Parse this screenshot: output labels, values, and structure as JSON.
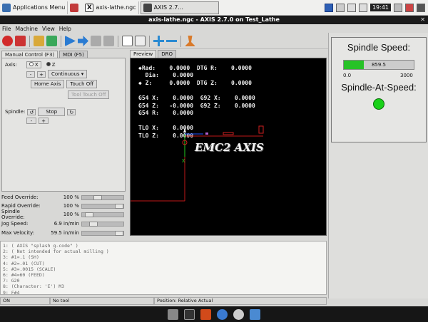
{
  "panel": {
    "apps_menu": "Applications Menu",
    "task1": "axis-lathe.ngc",
    "task2": "AXIS 2.7...",
    "clock": "19:41"
  },
  "window": {
    "title": "axis-lathe.ngc - AXIS 2.7.0 on Test_Lathe"
  },
  "menu": {
    "file": "File",
    "machine": "Machine",
    "view": "View",
    "help": "Help"
  },
  "left": {
    "tab_manual": "Manual Control (F3)",
    "tab_mdi": "MDI (F5)",
    "axis_label": "Axis:",
    "axis_x": "X",
    "axis_z": "Z",
    "jog_mode": "Continuous",
    "home_axis": "Home Axis",
    "touch_off": "Touch Off",
    "tool_touch_off": "Tool Touch Off",
    "spindle_label": "Spindle:",
    "spindle_stop": "Stop"
  },
  "overrides": {
    "feed_label": "Feed Override:",
    "feed_val": "100 %",
    "rapid_label": "Rapid Override:",
    "rapid_val": "100 %",
    "spindle_label": "Spindle Override:",
    "spindle_val": "100 %",
    "jog_label": "Jog Speed:",
    "jog_val": "6.9 in/min",
    "maxvel_label": "Max Velocity:",
    "maxvel_val": "59.5 in/min"
  },
  "preview": {
    "tab_preview": "Preview",
    "tab_dro": "DRO",
    "dro": [
      "◆Rad:    0.0000  DTG R:    0.0000",
      "  Dia:    0.0000",
      "◆ Z:     0.0000  DTG Z:    0.0000",
      "G54 X:    0.0000  G92 X:    0.0000",
      "G54 Z:   -0.0000  G92 Z:    0.0000",
      "G54 R:    0.0000",
      "TLO X:    0.0000",
      "TLO Z:    0.0000"
    ],
    "banner": "EMC2 AXIS",
    "axis_x_label": "X"
  },
  "gcode": {
    "lines": [
      "1: ( AXIS \"splash g-code\" )",
      "2: ( Not intended for actual milling )",
      "3: #1=.1 (SH)",
      "4: #2=.01 (CUT)",
      "5: #3=.0015 (SCALE)",
      "6: #4=60 (FEED)",
      "7: G20",
      "8: (Character: 'E') M3",
      "9: F#4"
    ]
  },
  "status": {
    "state": "ON",
    "tool": "No tool",
    "position": "Position: Relative Actual"
  },
  "pyvcp": {
    "spindle_speed_title": "Spindle Speed:",
    "spindle_speed_value": "859.5",
    "spindle_speed_fraction": 0.2865,
    "bar_min": "0.0",
    "bar_max": "3000",
    "at_speed_title": "Spindle-At-Speed:"
  },
  "colors": {
    "led_on": "#19d119",
    "bar_fill": "#27c227",
    "estop": "#d22a2a",
    "run": "#2a7bd2"
  }
}
